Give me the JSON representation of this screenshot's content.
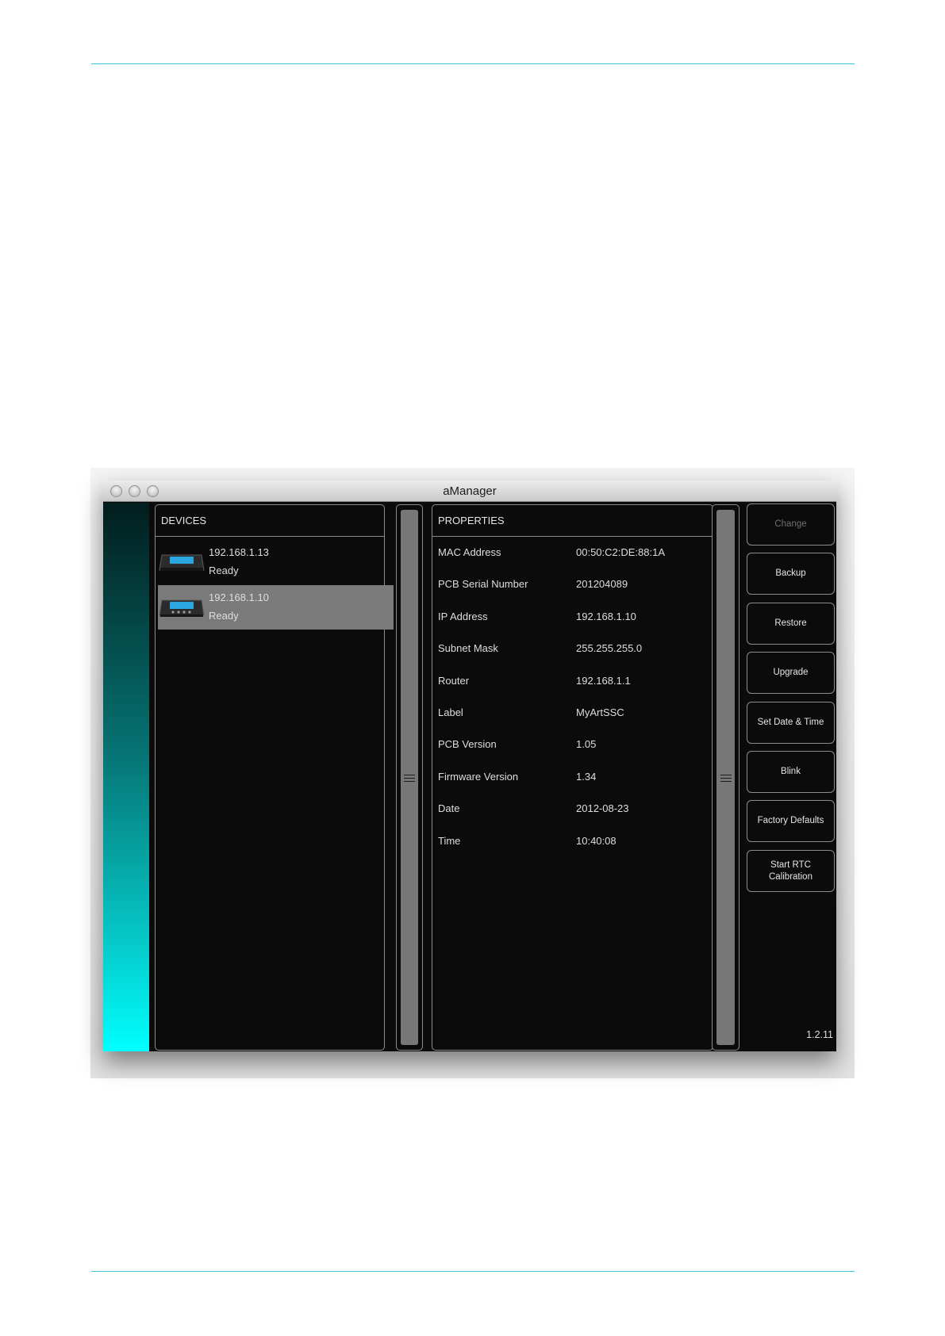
{
  "window": {
    "title": "aManager",
    "version": "1.2.11"
  },
  "devices": {
    "header": "DEVICES",
    "items": [
      {
        "ip": "192.168.1.13",
        "status": "Ready"
      },
      {
        "ip": "192.168.1.10",
        "status": "Ready"
      }
    ]
  },
  "properties": {
    "header": "PROPERTIES",
    "rows": [
      {
        "label": "MAC Address",
        "value": "00:50:C2:DE:88:1A"
      },
      {
        "label": "PCB Serial Number",
        "value": "201204089"
      },
      {
        "label": "IP Address",
        "value": "192.168.1.10"
      },
      {
        "label": "Subnet Mask",
        "value": "255.255.255.0"
      },
      {
        "label": "Router",
        "value": "192.168.1.1"
      },
      {
        "label": "Label",
        "value": "MyArtSSC"
      },
      {
        "label": "PCB Version",
        "value": "1.05"
      },
      {
        "label": "Firmware Version",
        "value": "1.34"
      },
      {
        "label": "Date",
        "value": "2012-08-23"
      },
      {
        "label": "Time",
        "value": "10:40:08"
      }
    ]
  },
  "actions": {
    "change": "Change",
    "backup": "Backup",
    "restore": "Restore",
    "upgrade": "Upgrade",
    "set_date_time": "Set Date & Time",
    "blink": "Blink",
    "factory_defaults": "Factory Defaults",
    "start_rtc_calibration": "Start RTC Calibration"
  },
  "colors": {
    "rule": "#39c6dc",
    "accent_top": "#021d1d",
    "accent_bottom": "#00ffff",
    "selected_row": "#7a7a7a",
    "device_led": "#2aa7e0"
  },
  "selected_device_index": 1
}
